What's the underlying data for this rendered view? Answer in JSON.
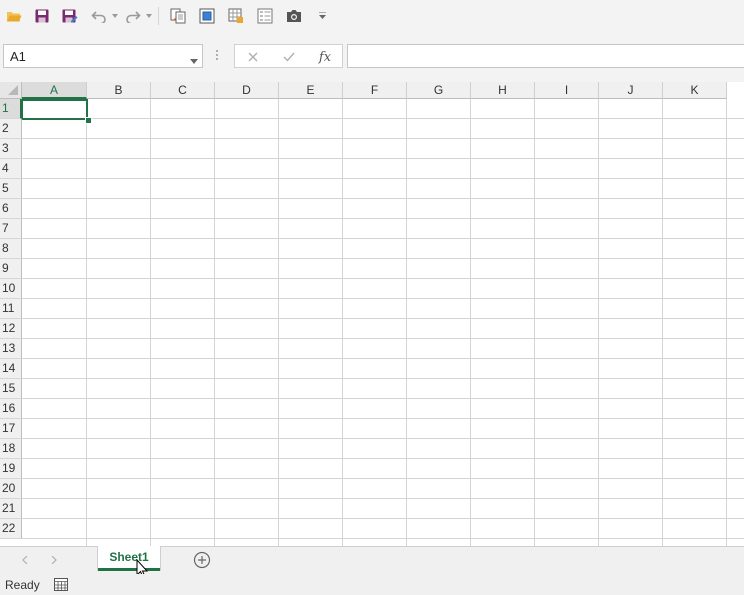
{
  "quick_access": {
    "icons": [
      "open-folder-icon",
      "save-icon",
      "save-as-icon",
      "undo-icon",
      "redo-icon",
      "copy-format-icon",
      "freeze-panes-icon",
      "protect-sheet-icon",
      "form-icon",
      "camera-icon",
      "customize-qat-icon"
    ]
  },
  "formula_bar": {
    "name_box": "A1",
    "fx_label": "fx",
    "formula_value": ""
  },
  "grid": {
    "columns": [
      "A",
      "B",
      "C",
      "D",
      "E",
      "F",
      "G",
      "H",
      "I",
      "J",
      "K"
    ],
    "rows": [
      "1",
      "2",
      "3",
      "4",
      "5",
      "6",
      "7",
      "8",
      "9",
      "10",
      "11",
      "12",
      "13",
      "14",
      "15",
      "16",
      "17",
      "18",
      "19",
      "20",
      "21",
      "22"
    ],
    "active_cell": "A1"
  },
  "sheets": {
    "tabs": [
      {
        "label": "Sheet1",
        "active": true
      }
    ]
  },
  "status": {
    "text": "Ready"
  },
  "colors": {
    "accent": "#217346",
    "toolbar_bg": "#f3f3f3",
    "header_bg": "#f0f0f0",
    "gridline": "#d4d4d4"
  }
}
